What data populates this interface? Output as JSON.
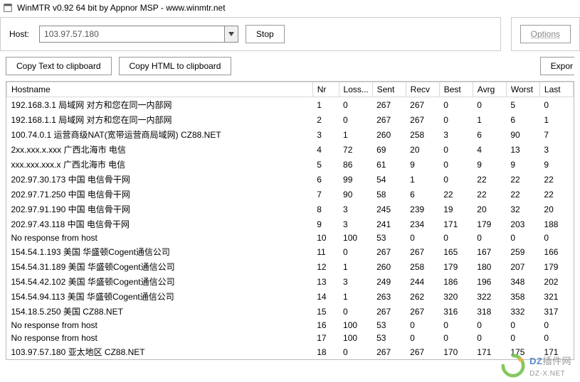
{
  "title": "WinMTR v0.92 64 bit by Appnor MSP - www.winmtr.net",
  "host": {
    "label": "Host:",
    "value": "103.97.57.180"
  },
  "buttons": {
    "stop": "Stop",
    "options": "Options",
    "copy_text": "Copy Text to clipboard",
    "copy_html": "Copy HTML to clipboard",
    "export": "Expor"
  },
  "columns": [
    "Hostname",
    "Nr",
    "Loss...",
    "Sent",
    "Recv",
    "Best",
    "Avrg",
    "Worst",
    "Last"
  ],
  "rows": [
    {
      "host": "192.168.3.1 局域网 对方和您在同一内部网",
      "nr": 1,
      "loss": 0,
      "sent": 267,
      "recv": 267,
      "best": 0,
      "avrg": 0,
      "worst": 5,
      "last": 0
    },
    {
      "host": "192.168.1.1 局域网 对方和您在同一内部网",
      "nr": 2,
      "loss": 0,
      "sent": 267,
      "recv": 267,
      "best": 0,
      "avrg": 1,
      "worst": 6,
      "last": 1
    },
    {
      "host": "100.74.0.1 运营商级NAT(宽带运营商局域网)  CZ88.NET",
      "nr": 3,
      "loss": 1,
      "sent": 260,
      "recv": 258,
      "best": 3,
      "avrg": 6,
      "worst": 90,
      "last": 7
    },
    {
      "host": "2xx.xxx.x.xxx 广西北海市 电信",
      "nr": 4,
      "loss": 72,
      "sent": 69,
      "recv": 20,
      "best": 0,
      "avrg": 4,
      "worst": 13,
      "last": 3
    },
    {
      "host": "xxx.xxx.xxx.x 广西北海市 电信",
      "nr": 5,
      "loss": 86,
      "sent": 61,
      "recv": 9,
      "best": 0,
      "avrg": 9,
      "worst": 9,
      "last": 9
    },
    {
      "host": "202.97.30.173 中国 电信骨干网",
      "nr": 6,
      "loss": 99,
      "sent": 54,
      "recv": 1,
      "best": 0,
      "avrg": 22,
      "worst": 22,
      "last": 22
    },
    {
      "host": "202.97.71.250 中国 电信骨干网",
      "nr": 7,
      "loss": 90,
      "sent": 58,
      "recv": 6,
      "best": 22,
      "avrg": 22,
      "worst": 22,
      "last": 22
    },
    {
      "host": "202.97.91.190 中国 电信骨干网",
      "nr": 8,
      "loss": 3,
      "sent": 245,
      "recv": 239,
      "best": 19,
      "avrg": 20,
      "worst": 32,
      "last": 20
    },
    {
      "host": "202.97.43.118 中国 电信骨干网",
      "nr": 9,
      "loss": 3,
      "sent": 241,
      "recv": 234,
      "best": 171,
      "avrg": 179,
      "worst": 203,
      "last": 188
    },
    {
      "host": "No response from host",
      "nr": 10,
      "loss": 100,
      "sent": 53,
      "recv": 0,
      "best": 0,
      "avrg": 0,
      "worst": 0,
      "last": 0
    },
    {
      "host": "154.54.1.193 美国 华盛顿Cogent通信公司",
      "nr": 11,
      "loss": 0,
      "sent": 267,
      "recv": 267,
      "best": 165,
      "avrg": 167,
      "worst": 259,
      "last": 166
    },
    {
      "host": "154.54.31.189 美国 华盛顿Cogent通信公司",
      "nr": 12,
      "loss": 1,
      "sent": 260,
      "recv": 258,
      "best": 179,
      "avrg": 180,
      "worst": 207,
      "last": 179
    },
    {
      "host": "154.54.42.102 美国 华盛顿Cogent通信公司",
      "nr": 13,
      "loss": 3,
      "sent": 249,
      "recv": 244,
      "best": 186,
      "avrg": 196,
      "worst": 348,
      "last": 202
    },
    {
      "host": "154.54.94.113 美国 华盛顿Cogent通信公司",
      "nr": 14,
      "loss": 1,
      "sent": 263,
      "recv": 262,
      "best": 320,
      "avrg": 322,
      "worst": 358,
      "last": 321
    },
    {
      "host": "154.18.5.250 美国  CZ88.NET",
      "nr": 15,
      "loss": 0,
      "sent": 267,
      "recv": 267,
      "best": 316,
      "avrg": 318,
      "worst": 332,
      "last": 317
    },
    {
      "host": "No response from host",
      "nr": 16,
      "loss": 100,
      "sent": 53,
      "recv": 0,
      "best": 0,
      "avrg": 0,
      "worst": 0,
      "last": 0
    },
    {
      "host": "No response from host",
      "nr": 17,
      "loss": 100,
      "sent": 53,
      "recv": 0,
      "best": 0,
      "avrg": 0,
      "worst": 0,
      "last": 0
    },
    {
      "host": "103.97.57.180 亚太地区  CZ88.NET",
      "nr": 18,
      "loss": 0,
      "sent": 267,
      "recv": 267,
      "best": 170,
      "avrg": 171,
      "worst": 175,
      "last": 171
    }
  ],
  "watermark": {
    "brand_a": "DZ",
    "brand_b": "插件网",
    "url": "DZ-X.NET"
  }
}
